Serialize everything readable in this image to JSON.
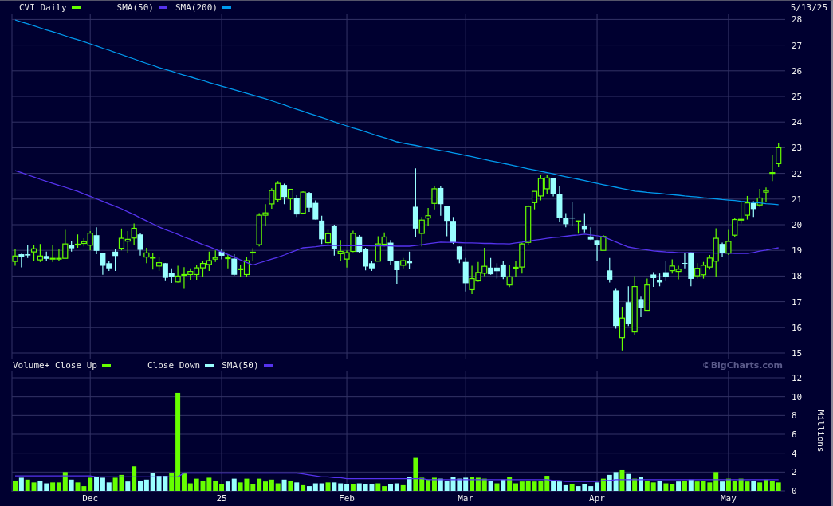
{
  "price_chart": {
    "date": "5/13/25",
    "chart_data": {
      "type": "candlestick",
      "title": "CVI Daily",
      "grid": true,
      "ylim": [
        15,
        28
      ],
      "yticks": [
        15,
        16,
        17,
        18,
        19,
        20,
        21,
        22,
        23,
        24,
        25,
        26,
        27,
        28
      ],
      "categories": [
        null,
        null,
        null,
        null,
        null,
        null,
        null,
        null,
        null,
        null,
        null,
        null,
        null,
        null,
        null,
        null,
        null,
        null,
        null,
        null,
        null,
        null,
        null,
        null,
        null,
        null,
        null,
        null,
        null,
        null,
        null,
        null,
        null,
        null,
        null,
        null,
        null,
        null,
        null,
        null,
        null,
        null,
        null,
        null,
        null,
        null,
        null,
        null,
        null,
        null,
        null,
        null,
        null,
        null,
        null,
        null,
        null,
        null,
        null,
        null,
        null,
        null,
        null,
        null,
        null,
        null,
        null,
        null,
        null,
        null,
        null,
        null,
        null,
        null,
        null,
        null,
        null,
        null,
        null,
        null,
        null,
        null,
        null,
        null,
        null,
        null,
        null,
        null,
        null,
        null,
        null,
        null,
        null,
        null,
        null,
        null,
        null,
        null,
        null,
        null,
        null,
        null,
        null,
        null,
        null,
        null,
        null,
        null,
        null,
        null,
        null,
        null,
        null,
        null,
        null,
        null,
        null,
        null,
        null,
        null,
        null,
        null,
        null
      ],
      "ohlc": [
        [
          18.57,
          19.06,
          18.4,
          18.78
        ],
        [
          18.85,
          18.87,
          18.34,
          18.74
        ],
        [
          18.85,
          19.2,
          18.7,
          18.8
        ],
        [
          18.94,
          19.2,
          18.6,
          19.06
        ],
        [
          18.63,
          19.25,
          18.55,
          18.78
        ],
        [
          18.78,
          18.95,
          18.6,
          18.67
        ],
        [
          18.68,
          19.2,
          18.55,
          18.69
        ],
        [
          18.67,
          19.05,
          18.6,
          18.69
        ],
        [
          18.69,
          19.8,
          18.69,
          19.25
        ],
        [
          19.2,
          19.35,
          18.95,
          19.08
        ],
        [
          19.22,
          19.62,
          19.1,
          19.24
        ],
        [
          19.27,
          19.47,
          19.15,
          19.34
        ],
        [
          19.2,
          19.75,
          19.0,
          19.67
        ],
        [
          19.59,
          19.9,
          18.85,
          18.98
        ],
        [
          18.91,
          18.91,
          18.05,
          18.4
        ],
        [
          18.5,
          18.6,
          18.2,
          18.3
        ],
        [
          18.95,
          19.05,
          18.2,
          18.78
        ],
        [
          19.08,
          19.85,
          19.0,
          19.47
        ],
        [
          19.36,
          19.75,
          18.9,
          19.43
        ],
        [
          19.48,
          20.05,
          19.22,
          19.86
        ],
        [
          19.62,
          19.67,
          18.8,
          19.02
        ],
        [
          18.74,
          19.1,
          18.5,
          18.9
        ],
        [
          18.71,
          18.9,
          18.25,
          18.73
        ],
        [
          18.39,
          18.74,
          18.2,
          18.52
        ],
        [
          18.5,
          18.5,
          17.8,
          17.93
        ],
        [
          18.12,
          18.3,
          17.73,
          17.95
        ],
        [
          17.77,
          18.4,
          17.75,
          18.0
        ],
        [
          18.04,
          18.35,
          17.5,
          18.06
        ],
        [
          18.06,
          18.3,
          17.85,
          18.18
        ],
        [
          18.06,
          18.45,
          17.85,
          18.32
        ],
        [
          18.32,
          18.6,
          17.95,
          18.49
        ],
        [
          18.45,
          18.95,
          18.2,
          18.6
        ],
        [
          18.66,
          19.0,
          18.55,
          18.72
        ],
        [
          18.95,
          19.05,
          18.65,
          18.79
        ],
        [
          18.69,
          18.85,
          18.3,
          18.71
        ],
        [
          18.68,
          18.85,
          18.02,
          18.05
        ],
        [
          18.26,
          18.45,
          17.95,
          18.28
        ],
        [
          18.06,
          18.75,
          17.95,
          18.6
        ],
        [
          18.91,
          19.08,
          18.6,
          18.93
        ],
        [
          19.22,
          20.45,
          19.15,
          20.37
        ],
        [
          20.37,
          20.8,
          19.95,
          20.46
        ],
        [
          20.81,
          21.42,
          20.62,
          21.33
        ],
        [
          20.98,
          21.7,
          20.9,
          21.61
        ],
        [
          21.55,
          21.6,
          20.8,
          21.08
        ],
        [
          21.02,
          21.4,
          20.58,
          21.38
        ],
        [
          21.03,
          21.15,
          20.3,
          20.4
        ],
        [
          20.45,
          21.3,
          20.4,
          21.27
        ],
        [
          21.24,
          21.27,
          20.5,
          20.66
        ],
        [
          20.85,
          20.95,
          20.2,
          20.2
        ],
        [
          20.16,
          20.35,
          19.25,
          19.43
        ],
        [
          19.3,
          19.8,
          19.2,
          19.65
        ],
        [
          19.96,
          20.0,
          18.8,
          19.05
        ],
        [
          18.87,
          19.4,
          18.6,
          18.96
        ],
        [
          18.66,
          19.0,
          18.33,
          18.91
        ],
        [
          18.96,
          19.77,
          18.93,
          19.66
        ],
        [
          19.54,
          19.6,
          18.9,
          18.94
        ],
        [
          19.04,
          19.1,
          18.22,
          18.37
        ],
        [
          18.5,
          18.6,
          18.2,
          18.3
        ],
        [
          18.58,
          19.55,
          18.58,
          19.25
        ],
        [
          19.24,
          19.7,
          19.15,
          19.52
        ],
        [
          19.3,
          19.4,
          18.45,
          18.6
        ],
        [
          18.6,
          18.6,
          17.7,
          18.23
        ],
        [
          18.42,
          18.7,
          18.3,
          18.6
        ],
        [
          18.57,
          18.95,
          18.27,
          18.5
        ],
        [
          20.7,
          22.2,
          19.5,
          19.85
        ],
        [
          19.66,
          20.3,
          19.15,
          20.18
        ],
        [
          20.26,
          20.65,
          19.97,
          20.35
        ],
        [
          20.83,
          21.5,
          20.6,
          21.4
        ],
        [
          21.43,
          21.5,
          20.35,
          20.8
        ],
        [
          20.74,
          20.74,
          19.55,
          20.15
        ],
        [
          20.15,
          20.3,
          19.25,
          19.3
        ],
        [
          19.15,
          19.15,
          18.5,
          18.65
        ],
        [
          18.55,
          18.7,
          17.4,
          17.72
        ],
        [
          17.47,
          18.4,
          17.3,
          17.9
        ],
        [
          17.81,
          18.55,
          17.78,
          18.14
        ],
        [
          18.11,
          19.1,
          18.0,
          18.38
        ],
        [
          18.33,
          18.7,
          18.05,
          18.07
        ],
        [
          18.33,
          18.5,
          17.9,
          18.19
        ],
        [
          18.45,
          18.6,
          17.88,
          17.97
        ],
        [
          17.65,
          18.45,
          17.57,
          17.97
        ],
        [
          18.32,
          18.6,
          17.97,
          18.34
        ],
        [
          18.35,
          19.3,
          18.1,
          19.25
        ],
        [
          19.31,
          20.75,
          19.2,
          20.71
        ],
        [
          20.86,
          21.3,
          20.6,
          21.3
        ],
        [
          21.12,
          21.95,
          20.95,
          21.8
        ],
        [
          21.4,
          21.95,
          21.2,
          21.82
        ],
        [
          21.82,
          21.82,
          21.1,
          21.2
        ],
        [
          21.18,
          21.5,
          20.1,
          20.28
        ],
        [
          20.28,
          20.45,
          19.9,
          20.02
        ],
        [
          20.28,
          20.9,
          19.97,
          20.24
        ],
        [
          20.14,
          20.16,
          19.65,
          20.15
        ],
        [
          19.97,
          20.45,
          19.7,
          19.8
        ],
        [
          19.54,
          19.9,
          19.4,
          19.42
        ],
        [
          19.4,
          19.4,
          18.58,
          19.22
        ],
        [
          19.0,
          19.6,
          19.0,
          19.54
        ],
        [
          18.22,
          18.7,
          17.75,
          17.86
        ],
        [
          17.44,
          17.5,
          15.95,
          16.05
        ],
        [
          15.6,
          16.8,
          15.1,
          16.36
        ],
        [
          16.98,
          17.6,
          16.05,
          16.13
        ],
        [
          15.82,
          18.0,
          15.7,
          17.59
        ],
        [
          17.1,
          17.2,
          16.4,
          16.77
        ],
        [
          16.66,
          17.9,
          16.66,
          17.65
        ],
        [
          18.06,
          18.15,
          17.58,
          17.92
        ],
        [
          17.85,
          18.1,
          17.6,
          17.75
        ],
        [
          18.15,
          18.6,
          17.8,
          17.95
        ],
        [
          18.21,
          18.65,
          18.1,
          18.39
        ],
        [
          18.18,
          18.4,
          17.87,
          18.27
        ],
        [
          18.51,
          18.9,
          18.3,
          18.49
        ],
        [
          18.92,
          18.92,
          17.6,
          17.89
        ],
        [
          18.01,
          18.5,
          17.9,
          18.3
        ],
        [
          18.05,
          18.55,
          17.9,
          18.42
        ],
        [
          18.35,
          18.82,
          18.25,
          18.7
        ],
        [
          18.58,
          19.86,
          17.98,
          19.47
        ],
        [
          19.25,
          19.3,
          18.75,
          18.89
        ],
        [
          18.89,
          19.8,
          18.82,
          19.35
        ],
        [
          19.59,
          20.25,
          19.5,
          20.2
        ],
        [
          20.19,
          20.9,
          20.05,
          20.21
        ],
        [
          20.37,
          21.12,
          20.2,
          20.85
        ],
        [
          20.85,
          20.92,
          20.3,
          20.61
        ],
        [
          20.77,
          21.4,
          20.7,
          21.04
        ],
        [
          21.27,
          21.45,
          20.9,
          21.33
        ],
        [
          22.01,
          22.7,
          21.7,
          22.03
        ],
        [
          22.38,
          23.2,
          22.25,
          23.0
        ]
      ],
      "series": [
        {
          "name": "SMA(50)",
          "type": "line",
          "color": "#5533ee",
          "values": [
            22.11,
            22.03,
            21.94,
            21.86,
            21.77,
            21.69,
            21.61,
            21.53,
            21.46,
            21.38,
            21.3,
            21.2,
            21.11,
            21.01,
            20.91,
            20.81,
            20.72,
            20.62,
            20.5,
            20.39,
            20.27,
            20.15,
            20.03,
            19.91,
            19.81,
            19.72,
            19.62,
            19.52,
            19.43,
            19.33,
            19.23,
            19.14,
            19.04,
            18.94,
            18.84,
            18.74,
            18.63,
            18.53,
            18.43,
            18.51,
            18.58,
            18.66,
            18.73,
            18.82,
            18.92,
            19.01,
            19.1,
            19.12,
            19.14,
            19.17,
            19.19,
            19.19,
            19.19,
            19.18,
            19.18,
            19.18,
            19.18,
            19.17,
            19.17,
            19.17,
            19.17,
            19.16,
            19.16,
            19.16,
            19.19,
            19.22,
            19.26,
            19.29,
            19.32,
            19.31,
            19.31,
            19.3,
            19.29,
            19.29,
            19.28,
            19.27,
            19.27,
            19.26,
            19.26,
            19.25,
            19.29,
            19.32,
            19.36,
            19.4,
            19.43,
            19.47,
            19.5,
            19.52,
            19.55,
            19.58,
            19.6,
            19.63,
            19.6,
            19.57,
            19.53,
            19.43,
            19.33,
            19.23,
            19.13,
            19.09,
            19.05,
            19.02,
            18.98,
            18.96,
            18.94,
            18.93,
            18.91,
            18.91,
            18.91,
            18.9,
            18.9,
            18.9,
            18.89,
            18.89,
            18.89,
            18.88,
            18.88,
            18.88,
            18.92,
            18.97,
            19.01,
            19.06,
            19.1
          ]
        },
        {
          "name": "SMA(200)",
          "type": "line",
          "color": "#0099ee",
          "values": [
            27.98,
            27.9,
            27.83,
            27.75,
            27.67,
            27.59,
            27.52,
            27.44,
            27.36,
            27.28,
            27.21,
            27.13,
            27.05,
            26.97,
            26.88,
            26.8,
            26.71,
            26.63,
            26.54,
            26.46,
            26.37,
            26.29,
            26.21,
            26.12,
            26.05,
            25.98,
            25.9,
            25.83,
            25.76,
            25.69,
            25.62,
            25.54,
            25.47,
            25.4,
            25.33,
            25.26,
            25.19,
            25.12,
            25.05,
            24.98,
            24.91,
            24.83,
            24.75,
            24.67,
            24.58,
            24.5,
            24.42,
            24.34,
            24.26,
            24.18,
            24.1,
            24.01,
            23.93,
            23.85,
            23.77,
            23.7,
            23.62,
            23.54,
            23.46,
            23.39,
            23.31,
            23.23,
            23.18,
            23.13,
            23.09,
            23.04,
            22.99,
            22.94,
            22.89,
            22.85,
            22.8,
            22.75,
            22.7,
            22.65,
            22.6,
            22.54,
            22.49,
            22.44,
            22.39,
            22.34,
            22.29,
            22.23,
            22.18,
            22.13,
            22.08,
            22.03,
            21.98,
            21.92,
            21.87,
            21.82,
            21.77,
            21.72,
            21.66,
            21.61,
            21.56,
            21.51,
            21.46,
            21.41,
            21.36,
            21.31,
            21.29,
            21.26,
            21.24,
            21.22,
            21.19,
            21.17,
            21.15,
            21.12,
            21.1,
            21.08,
            21.05,
            21.03,
            21.01,
            20.98,
            20.96,
            20.94,
            20.91,
            20.89,
            20.87,
            20.85,
            20.82,
            20.8,
            20.78
          ]
        }
      ]
    }
  },
  "volume_chart": {
    "copyright": "©BigCharts.com",
    "chart_data": {
      "type": "bar",
      "grid": true,
      "ylabel": "Millions",
      "ylim": [
        0,
        12
      ],
      "yticks": [
        0,
        2,
        4,
        6,
        8,
        10,
        12
      ],
      "categories": [
        null,
        null,
        null,
        null,
        null,
        null,
        null,
        null,
        null,
        null,
        null,
        null,
        "Dec",
        null,
        null,
        null,
        null,
        null,
        null,
        null,
        null,
        null,
        null,
        null,
        null,
        null,
        null,
        null,
        null,
        null,
        null,
        null,
        null,
        "25",
        null,
        null,
        null,
        null,
        null,
        null,
        null,
        null,
        null,
        null,
        null,
        null,
        null,
        null,
        null,
        null,
        null,
        null,
        null,
        "Feb",
        null,
        null,
        null,
        null,
        null,
        null,
        null,
        null,
        null,
        null,
        null,
        null,
        null,
        null,
        null,
        null,
        null,
        null,
        "Mar",
        null,
        null,
        null,
        null,
        null,
        null,
        null,
        null,
        null,
        null,
        null,
        null,
        null,
        null,
        null,
        null,
        null,
        null,
        null,
        null,
        "Apr",
        null,
        null,
        null,
        null,
        null,
        null,
        null,
        null,
        null,
        null,
        null,
        null,
        null,
        null,
        null,
        null,
        null,
        null,
        null,
        null,
        "May",
        null,
        null,
        null,
        null,
        null,
        null,
        null,
        null
      ],
      "series": [
        {
          "name": "Volume+ Close Up",
          "color": "#66ff00",
          "values": [
            1.1,
            null,
            1.2,
            0.9,
            null,
            null,
            0.9,
            0.9,
            2.0,
            null,
            0.9,
            0.5,
            1.4,
            null,
            null,
            null,
            1.4,
            1.7,
            null,
            2.6,
            null,
            null,
            null,
            null,
            null,
            1.9,
            10.4,
            1.9,
            0.8,
            1.3,
            1.1,
            1.4,
            1.1,
            0.7,
            null,
            null,
            0.9,
            1.3,
            0.7,
            1.3,
            1.0,
            1.2,
            0.8,
            null,
            1.1,
            null,
            0.6,
            null,
            null,
            null,
            0.9,
            null,
            null,
            null,
            0.7,
            null,
            null,
            null,
            0.8,
            0.5,
            null,
            null,
            0.6,
            null,
            3.5,
            1.4,
            1.2,
            1.4,
            null,
            null,
            null,
            null,
            null,
            1.5,
            1.4,
            1.3,
            null,
            0.8,
            null,
            1.5,
            0.8,
            1.0,
            1.1,
            1.0,
            1.1,
            1.6,
            null,
            null,
            null,
            0.7,
            null,
            null,
            null,
            null,
            1.3,
            null,
            null,
            2.2,
            null,
            1.3,
            null,
            1.1,
            0.9,
            null,
            0.8,
            0.7,
            null,
            1.1,
            null,
            1.0,
            1.1,
            0.9,
            2.0,
            null,
            1.3,
            1.1,
            1.3,
            1.0,
            null,
            0.9,
            1.2,
            1.1,
            0.9
          ]
        },
        {
          "name": "Close Down",
          "color": "#99ffff",
          "values": [
            null,
            1.4,
            null,
            null,
            1.1,
            0.8,
            null,
            null,
            null,
            1.2,
            null,
            null,
            null,
            1.5,
            1.4,
            0.9,
            null,
            null,
            1.0,
            null,
            1.1,
            1.2,
            1.9,
            1.6,
            1.6,
            null,
            null,
            null,
            null,
            null,
            null,
            null,
            null,
            null,
            1.0,
            1.3,
            null,
            null,
            null,
            null,
            null,
            null,
            null,
            1.2,
            null,
            0.9,
            null,
            0.5,
            0.8,
            0.8,
            null,
            0.9,
            0.8,
            0.7,
            null,
            0.8,
            0.7,
            0.7,
            null,
            null,
            0.7,
            0.8,
            null,
            1.5,
            null,
            null,
            null,
            null,
            1.3,
            1.1,
            1.5,
            1.3,
            1.4,
            null,
            null,
            null,
            1.1,
            null,
            1.2,
            null,
            null,
            null,
            null,
            null,
            null,
            null,
            1.1,
            1.0,
            0.6,
            null,
            0.5,
            0.7,
            0.5,
            0.9,
            null,
            1.7,
            2.0,
            null,
            1.8,
            null,
            1.5,
            null,
            null,
            1.1,
            null,
            null,
            1.0,
            null,
            1.2,
            null,
            null,
            null,
            null,
            1.0,
            null,
            null,
            null,
            null,
            1.1,
            null,
            null,
            null,
            null
          ]
        },
        {
          "name": "SMA(50)",
          "type": "line",
          "color": "#5533ee",
          "values": [
            1.6,
            1.6,
            1.6,
            1.6,
            1.6,
            1.6,
            1.6,
            1.6,
            1.6,
            1.6,
            1.6,
            1.6,
            1.6,
            1.5,
            1.5,
            1.5,
            1.5,
            1.5,
            1.5,
            1.5,
            1.5,
            1.5,
            1.5,
            1.5,
            1.5,
            1.5,
            1.5,
            1.9,
            1.9,
            1.9,
            1.9,
            1.9,
            1.9,
            1.9,
            1.9,
            1.9,
            1.9,
            1.9,
            1.9,
            1.9,
            1.9,
            1.9,
            1.9,
            1.9,
            1.9,
            1.9,
            1.8,
            1.7,
            1.6,
            1.5,
            1.5,
            1.4,
            1.4,
            1.3,
            1.3,
            1.3,
            1.3,
            1.3,
            1.3,
            1.3,
            1.3,
            1.3,
            1.3,
            1.3,
            1.3,
            1.3,
            1.2,
            1.2,
            1.2,
            1.2,
            1.2,
            1.2,
            1.2,
            1.2,
            1.2,
            1.2,
            1.2,
            1.2,
            1.2,
            1.2,
            1.2,
            1.2,
            1.2,
            1.2,
            1.2,
            1.2,
            1.1,
            1.1,
            1.0,
            1.0,
            1.0,
            1.0,
            1.0,
            1.0,
            1.1,
            1.1,
            1.2,
            1.2,
            1.2,
            1.2,
            1.2,
            1.2,
            1.2,
            1.2,
            1.2,
            1.2,
            1.2,
            1.2,
            1.2,
            1.2,
            1.2,
            1.2,
            1.2,
            1.2,
            1.2,
            1.2,
            1.2,
            1.2,
            1.2,
            1.2,
            1.2,
            1.2,
            1.2
          ]
        }
      ]
    }
  }
}
